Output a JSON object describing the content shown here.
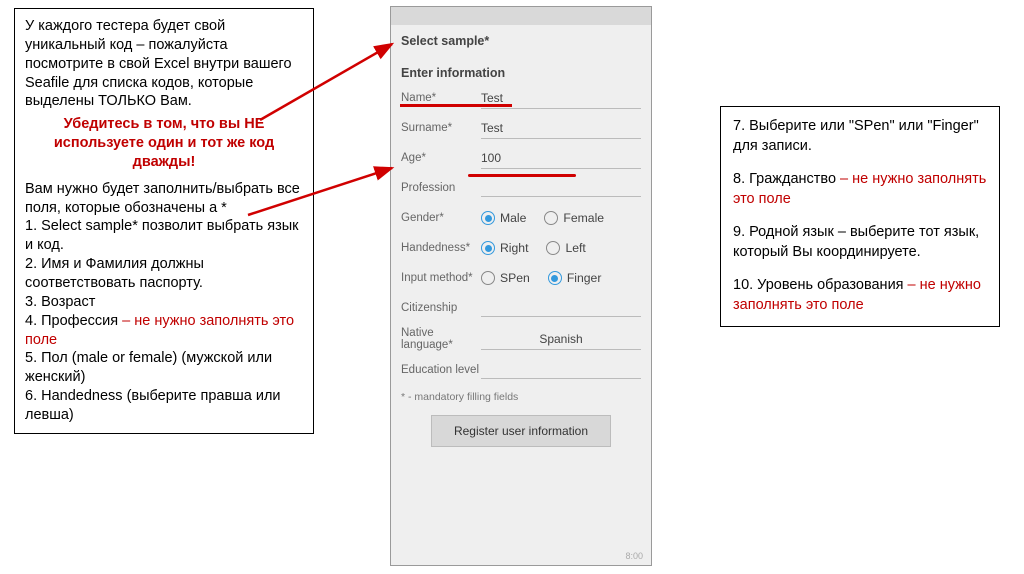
{
  "left": {
    "intro": "У каждого тестера будет свой уникальный код  – пожалуйста посмотрите в свой Excel внутри вашего Seafile для списка кодов, которые выделены ТОЛЬКО Вам.",
    "warn": "Убедитесь в том, что вы НЕ используете один и тот же код дважды!",
    "pre_list": "Вам нужно будет заполнить/выбрать все поля, которые обозначены а *",
    "item1": "1. Select sample* позволит выбрать язык и код.",
    "item2": "2. Имя и Фамилия должны соответствовать паспорту.",
    "item3": "3. Возраст",
    "item4_a": "4. Профессия",
    "item4_b": " – не нужно заполнять это поле",
    "item5": "5. Пол (male or female) (мужской или женский)",
    "item6": "6. Handedness (выберите правша или левша)"
  },
  "right": {
    "item7": "7. Выберите или \"SPen\" или \"Finger\" для записи.",
    "item8_a": "8. Гражданство",
    "item8_b": " – не нужно заполнять это поле",
    "item9": "9. Родной язык – выберите тот язык, который Вы координируете.",
    "item10_a": "10. Уровень образования",
    "item10_b": " – не нужно заполнять это поле"
  },
  "phone": {
    "select_sample": "Select sample*",
    "enter_info": "Enter information",
    "name_label": "Name*",
    "name_value": "Test",
    "surname_label": "Surname*",
    "surname_value": "Test",
    "age_label": "Age*",
    "age_value": "100",
    "profession_label": "Profession",
    "profession_value": "",
    "gender_label": "Gender*",
    "gender_male": "Male",
    "gender_female": "Female",
    "handed_label": "Handedness*",
    "handed_right": "Right",
    "handed_left": "Left",
    "input_label": "Input method*",
    "input_spen": "SPen",
    "input_finger": "Finger",
    "citizenship_label": "Citizenship",
    "citizenship_value": "",
    "native_label": "Native language*",
    "native_value": "Spanish",
    "edu_label": "Education level",
    "edu_value": "",
    "footnote": "* - mandatory filling fields",
    "register": "Register user information",
    "clock": "8:00"
  }
}
